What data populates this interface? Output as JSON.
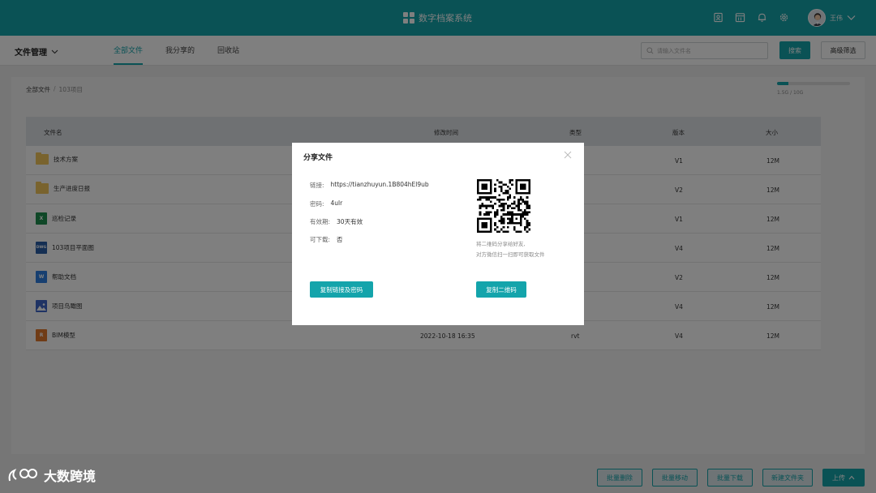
{
  "app": {
    "title": "数字档案系统"
  },
  "user": {
    "name": "王伟"
  },
  "topbar": {
    "icons": [
      "contact-card-icon",
      "calendar-icon",
      "bell-icon",
      "gear-icon"
    ]
  },
  "subnav": {
    "module": "文件管理",
    "tabs": [
      {
        "label": "全部文件",
        "active": true
      },
      {
        "label": "我分享的",
        "active": false
      },
      {
        "label": "回收站",
        "active": false
      }
    ],
    "search_placeholder": "请输入文件名",
    "search_button": "搜索",
    "advanced_button": "高级筛选"
  },
  "breadcrumb": {
    "root": "全部文件",
    "separator": "/",
    "current": "103项目"
  },
  "storage": {
    "text": "1.5G / 10G",
    "fraction": 0.15
  },
  "table": {
    "headers": {
      "name": "文件名",
      "modified": "修改时间",
      "type": "类型",
      "version": "版本",
      "size": "大小"
    },
    "rows": [
      {
        "name": "技术方案",
        "icon": "folder-icon",
        "modified": "",
        "type": "",
        "version": "V1",
        "size": "12M"
      },
      {
        "name": "生产进度日报",
        "icon": "folder-icon",
        "modified": "",
        "type": "",
        "version": "V2",
        "size": "12M"
      },
      {
        "name": "巡检记录",
        "icon": "excel-file-icon",
        "modified": "",
        "type": "",
        "version": "V1",
        "size": "12M"
      },
      {
        "name": "103项目平面图",
        "icon": "dwg-file-icon",
        "modified": "",
        "type": "",
        "version": "V4",
        "size": "12M"
      },
      {
        "name": "帮助文档",
        "icon": "word-file-icon",
        "modified": "",
        "type": "",
        "version": "V2",
        "size": "12M"
      },
      {
        "name": "项目鸟瞰图",
        "icon": "image-file-icon",
        "modified": "",
        "type": "",
        "version": "V4",
        "size": "12M"
      },
      {
        "name": "BIM模型",
        "icon": "rvt-file-icon",
        "modified": "2022-10-18 16:35",
        "type": "rvt",
        "version": "V4",
        "size": "12M"
      }
    ]
  },
  "icon_labels": {
    "excel": "X",
    "dwg": "DWG",
    "word": "W",
    "rvt": "R"
  },
  "modal": {
    "title": "分享文件",
    "link_label": "链接:",
    "link_value": "https://tianzhuyun.1B804hEl9ub",
    "password_label": "密码:",
    "password_value": "4ulr",
    "validity_label": "有效期:",
    "validity_value": "30天有效",
    "download_label": "可下载:",
    "download_value": "否",
    "qr_caption_line1": "将二维码分享给好友,",
    "qr_caption_line2": "对方微信扫一扫即可获取文件",
    "copy_link_button": "复制链接及密码",
    "copy_qr_button": "复制二维码"
  },
  "footer": {
    "batch_delete": "批量删除",
    "batch_move": "批量移动",
    "batch_download": "批量下载",
    "new_folder": "新建文件夹",
    "upload": "上传"
  },
  "watermark": {
    "text": "大数跨境"
  },
  "colors": {
    "accent": "#14a4ab",
    "folder": "#f2c75c",
    "excel": "#1f8f4e",
    "word": "#2f7fe0",
    "dwg": "#2b5fa6",
    "rvt": "#e0782c"
  }
}
